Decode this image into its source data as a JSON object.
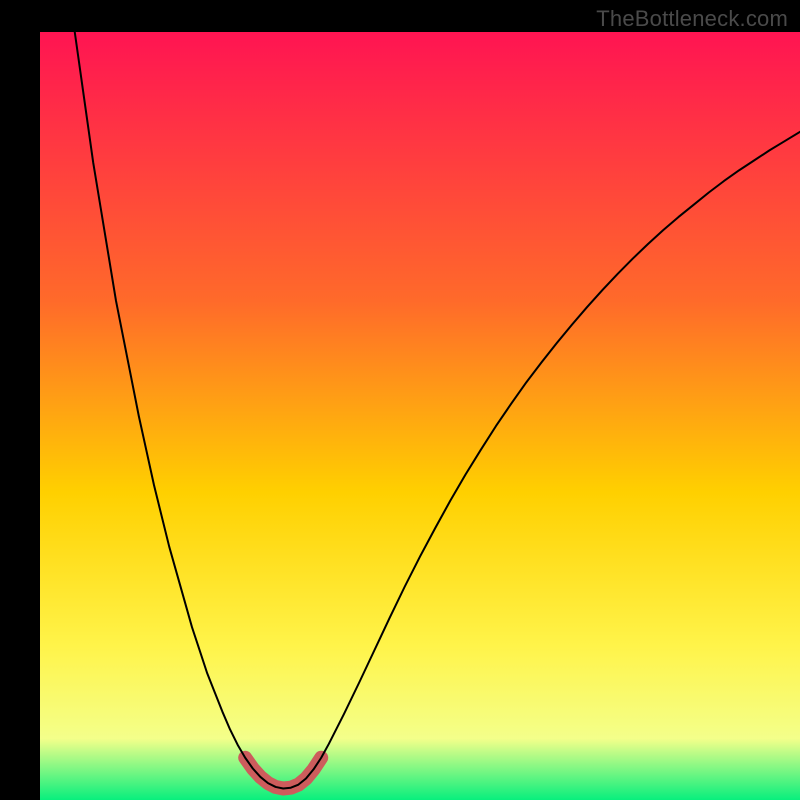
{
  "watermark": "TheBottleneck.com",
  "colors": {
    "bg_black": "#000000",
    "gradient_top": "#ff1452",
    "gradient_mid1": "#ff6a2a",
    "gradient_mid2": "#ffd000",
    "gradient_mid3": "#fff44a",
    "gradient_mid4": "#f4ff8a",
    "gradient_bottom": "#08ef7d",
    "curve": "#000000",
    "highlight": "#cd5c5c"
  },
  "chart_data": {
    "type": "line",
    "title": "",
    "xlabel": "",
    "ylabel": "",
    "xlim": [
      0,
      100
    ],
    "ylim": [
      0,
      100
    ],
    "x": [
      0,
      1,
      2,
      3,
      4,
      5,
      6,
      7,
      8,
      9,
      10,
      11,
      12,
      13,
      14,
      15,
      16,
      17,
      18,
      19,
      20,
      21,
      22,
      23,
      24,
      25,
      26,
      27,
      28,
      29,
      30,
      31,
      32,
      33,
      34,
      35,
      36,
      37,
      38,
      40,
      42,
      44,
      46,
      48,
      50,
      52,
      54,
      56,
      58,
      60,
      62,
      64,
      66,
      68,
      70,
      72,
      74,
      76,
      78,
      80,
      82,
      84,
      86,
      88,
      90,
      92,
      94,
      96,
      98,
      100
    ],
    "values": [
      135,
      127,
      119,
      111,
      104,
      97,
      90,
      83,
      77,
      71,
      65,
      60,
      55,
      50,
      45.5,
      41,
      37,
      33,
      29.5,
      26,
      22.5,
      19.5,
      16.5,
      14,
      11.5,
      9.2,
      7.2,
      5.5,
      4.1,
      3.0,
      2.2,
      1.7,
      1.5,
      1.6,
      2.0,
      2.8,
      4.0,
      5.5,
      7.3,
      11.2,
      15.3,
      19.5,
      23.7,
      27.8,
      31.7,
      35.4,
      39.0,
      42.4,
      45.6,
      48.7,
      51.6,
      54.4,
      57.0,
      59.5,
      61.9,
      64.2,
      66.4,
      68.5,
      70.5,
      72.4,
      74.2,
      75.9,
      77.5,
      79.1,
      80.6,
      82.0,
      83.3,
      84.6,
      85.8,
      87.0
    ],
    "grid": false,
    "legend": false,
    "highlight_range_x": [
      27,
      37
    ],
    "note": "V-shaped bottleneck curve with minimum ~x=32; highlighted pink segment near trough."
  }
}
